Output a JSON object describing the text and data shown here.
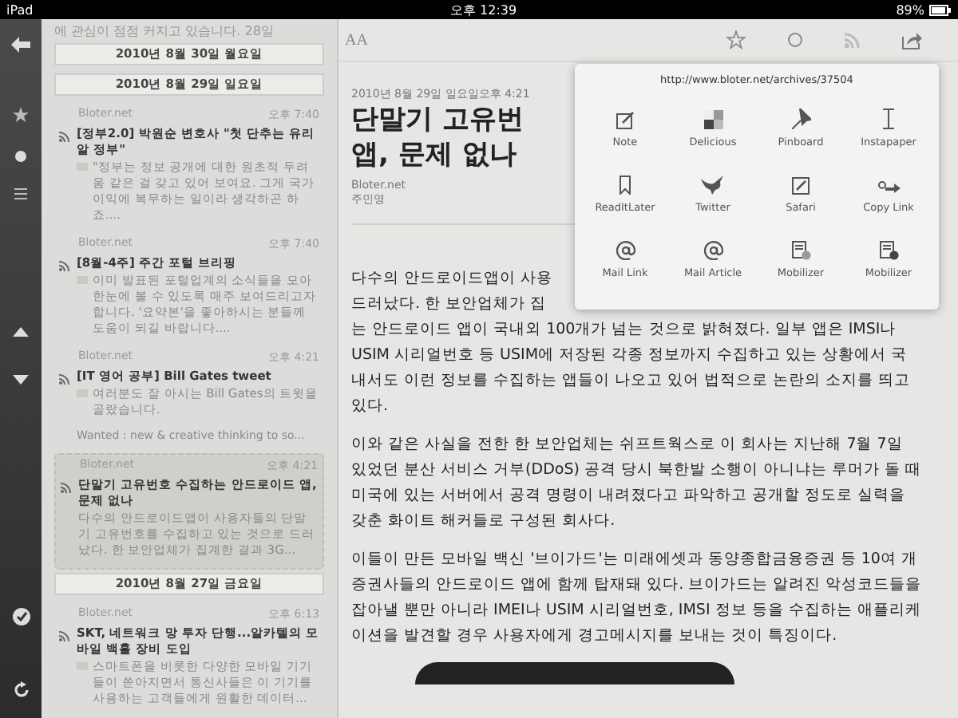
{
  "status_bar": {
    "device": "iPad",
    "time": "오후 12:39",
    "battery": "89%"
  },
  "list": [
    {
      "kind": "text",
      "text": "에 관심이 점점 커지고 있습니다. 28일"
    },
    {
      "kind": "date",
      "text": "2010년 8월 30일 월요일"
    },
    {
      "kind": "date",
      "text": "2010년 8월 29일 일요일"
    },
    {
      "kind": "item",
      "source": "Bloter.net",
      "time": "오후 7:40",
      "title": "[정부2.0] 박원순 변호사 \"첫 단추는 유리알 정부\"",
      "excerpt": "\"정부는 정보 공개에 대한 원초적 두려움 같은 걸 갖고 있어 보여요. 그게 국가 이익에 복무하는 일이라 생각하곤 하죠....",
      "note_mark": true,
      "selected": false
    },
    {
      "kind": "item",
      "source": "Bloter.net",
      "time": "오후 7:40",
      "title": "[8월-4주] 주간 포털 브리핑",
      "excerpt": "이미 발표된 포털업계의 소식들을 모아 한눈에 볼 수 있도록 매주 보여드리고자 합니다. '요약본'을 좋아하시는 분들께 도움이 되길 바랍니다....",
      "note_mark": true,
      "selected": false
    },
    {
      "kind": "item",
      "source": "Bloter.net",
      "time": "오후 4:21",
      "title": "[IT 영어 공부] Bill Gates tweet",
      "excerpt": "여러분도 잘 아시는 Bill Gates의 트윗을 골랐습니다.",
      "extra": "Wanted : new & creative thinking to so...",
      "note_mark": true,
      "selected": false
    },
    {
      "kind": "item",
      "source": "Bloter.net",
      "time": "오후 4:21",
      "title": "단말기 고유번호 수집하는 안드로이드 앱, 문제 없나",
      "excerpt": "다수의 안드로이드앱이 사용자들의 단말기 고유번호를 수집하고 있는 것으로 드러났다. 한 보안업체가 집계한 결과 3G...",
      "note_mark": false,
      "selected": true
    },
    {
      "kind": "date",
      "text": "2010년 8월 27일 금요일"
    },
    {
      "kind": "item",
      "source": "Bloter.net",
      "time": "오후 6:13",
      "title": "SKT, 네트워크 망 투자 단행...알카텔의 모바일 백홀 장비 도입",
      "excerpt": "스마트폰을 비롯한 다양한 모바일 기기들이 쏟아지면서 통신사들은 이 기기를 사용하는 고객들에게 원활한 데이터...",
      "note_mark": true,
      "selected": false
    }
  ],
  "toolbar": {
    "font_button": "AA"
  },
  "article": {
    "date": "2010년 8월 29일 일요일오후 4:21",
    "title_lines": [
      "단말기 고유번",
      "앱, 문제 없나"
    ],
    "source": "Bloter.net",
    "author": "주민영",
    "first_lines": [
      "다수의 안드로이드앱이 사용",
      "드러났다. 한 보안업체가 집"
    ],
    "paragraphs": [
      "는 안드로이드 앱이 국내외 100개가 넘는 것으로 밝혀졌다. 일부 앱은 IMSI나 USIM 시리얼번호 등 USIM에 저장된 각종 정보까지 수집하고 있는 상황에서 국내서도 이런 정보를 수집하는 앱들이 나오고 있어 법적으로 논란의 소지를 띄고 있다.",
      "이와 같은 사실을 전한 한 보안업체는 쉬프트웍스로 이 회사는 지난해 7월 7일 있었던 분산 서비스 거부(DDoS) 공격 당시 북한발 소행이 아니냐는 루머가 돌 때 미국에 있는 서버에서 공격 명령이 내려졌다고 파악하고 공개할 정도로 실력을 갖춘 화이트 해커들로 구성된 회사다.",
      "이들이 만든 모바일 백신 '브이가드'는 미래에셋과 동양종합금융증권 등 10여 개 증권사들의 안드로이드 앱에 함께 탑재돼 있다. 브이가드는 알려진 악성코드들을 잡아낼 뿐만 아니라 IMEI나 USIM 시리얼번호, IMSI 정보 등을 수집하는 애플리케이션을 발견할 경우 사용자에게 경고메시지를 보내는 것이 특징이다."
    ]
  },
  "share_menu": {
    "url": "http://www.bloter.net/archives/37504",
    "items": [
      {
        "kind": "note",
        "label": "Note"
      },
      {
        "kind": "delicious",
        "label": "Delicious"
      },
      {
        "kind": "pinboard",
        "label": "Pinboard"
      },
      {
        "kind": "instapaper",
        "label": "Instapaper"
      },
      {
        "kind": "readitlater",
        "label": "ReadItLater"
      },
      {
        "kind": "twitter",
        "label": "Twitter"
      },
      {
        "kind": "safari",
        "label": "Safari"
      },
      {
        "kind": "copylink",
        "label": "Copy Link"
      },
      {
        "kind": "mail",
        "label": "Mail Link"
      },
      {
        "kind": "mail",
        "label": "Mail Article"
      },
      {
        "kind": "mobilizer",
        "label": "Mobilizer"
      },
      {
        "kind": "mobilizer-info",
        "label": "Mobilizer"
      }
    ]
  }
}
